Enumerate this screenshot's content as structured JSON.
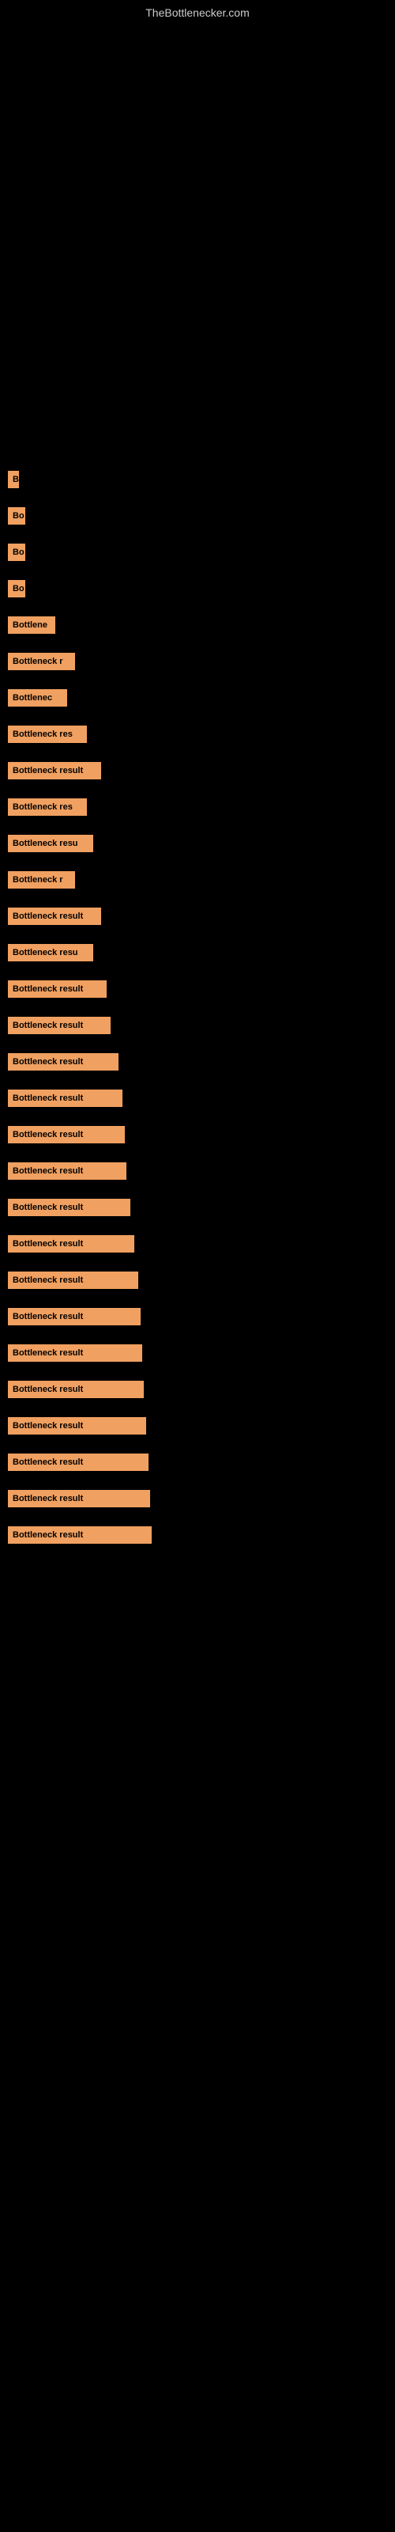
{
  "site": {
    "title": "TheBottlenecker.com"
  },
  "results": [
    {
      "label": "",
      "width": 2,
      "visible": false
    },
    {
      "label": "",
      "width": 2,
      "visible": false
    },
    {
      "label": "",
      "width": 2,
      "visible": false
    },
    {
      "label": "",
      "width": 2,
      "visible": false
    },
    {
      "label": "",
      "width": 2,
      "visible": false
    },
    {
      "label": "",
      "width": 2,
      "visible": false
    },
    {
      "label": "",
      "width": 2,
      "visible": false
    },
    {
      "label": "",
      "width": 4,
      "visible": false
    },
    {
      "label": "B",
      "width": 14,
      "visible": true
    },
    {
      "label": "Bo",
      "width": 22,
      "visible": true
    },
    {
      "label": "Bo",
      "width": 22,
      "visible": true
    },
    {
      "label": "Bo",
      "width": 22,
      "visible": true
    },
    {
      "label": "Bottlene",
      "width": 60,
      "visible": true
    },
    {
      "label": "Bottleneck r",
      "width": 85,
      "visible": true
    },
    {
      "label": "Bottlenec",
      "width": 75,
      "visible": true
    },
    {
      "label": "Bottleneck res",
      "width": 100,
      "visible": true
    },
    {
      "label": "Bottleneck result",
      "width": 118,
      "visible": true
    },
    {
      "label": "Bottleneck res",
      "width": 100,
      "visible": true
    },
    {
      "label": "Bottleneck resu",
      "width": 108,
      "visible": true
    },
    {
      "label": "Bottleneck r",
      "width": 85,
      "visible": true
    },
    {
      "label": "Bottleneck result",
      "width": 118,
      "visible": true
    },
    {
      "label": "Bottleneck resu",
      "width": 108,
      "visible": true
    },
    {
      "label": "Bottleneck result",
      "width": 125,
      "visible": true
    },
    {
      "label": "Bottleneck result",
      "width": 130,
      "visible": true
    },
    {
      "label": "Bottleneck result",
      "width": 140,
      "visible": true
    },
    {
      "label": "Bottleneck result",
      "width": 145,
      "visible": true
    },
    {
      "label": "Bottleneck result",
      "width": 148,
      "visible": true
    },
    {
      "label": "Bottleneck result",
      "width": 150,
      "visible": true
    },
    {
      "label": "Bottleneck result",
      "width": 155,
      "visible": true
    },
    {
      "label": "Bottleneck result",
      "width": 160,
      "visible": true
    },
    {
      "label": "Bottleneck result",
      "width": 165,
      "visible": true
    },
    {
      "label": "Bottleneck result",
      "width": 168,
      "visible": true
    },
    {
      "label": "Bottleneck result",
      "width": 170,
      "visible": true
    },
    {
      "label": "Bottleneck result",
      "width": 172,
      "visible": true
    },
    {
      "label": "Bottleneck result",
      "width": 175,
      "visible": true
    },
    {
      "label": "Bottleneck result",
      "width": 178,
      "visible": true
    },
    {
      "label": "Bottleneck result",
      "width": 180,
      "visible": true
    },
    {
      "label": "Bottleneck result",
      "width": 182,
      "visible": true
    }
  ]
}
